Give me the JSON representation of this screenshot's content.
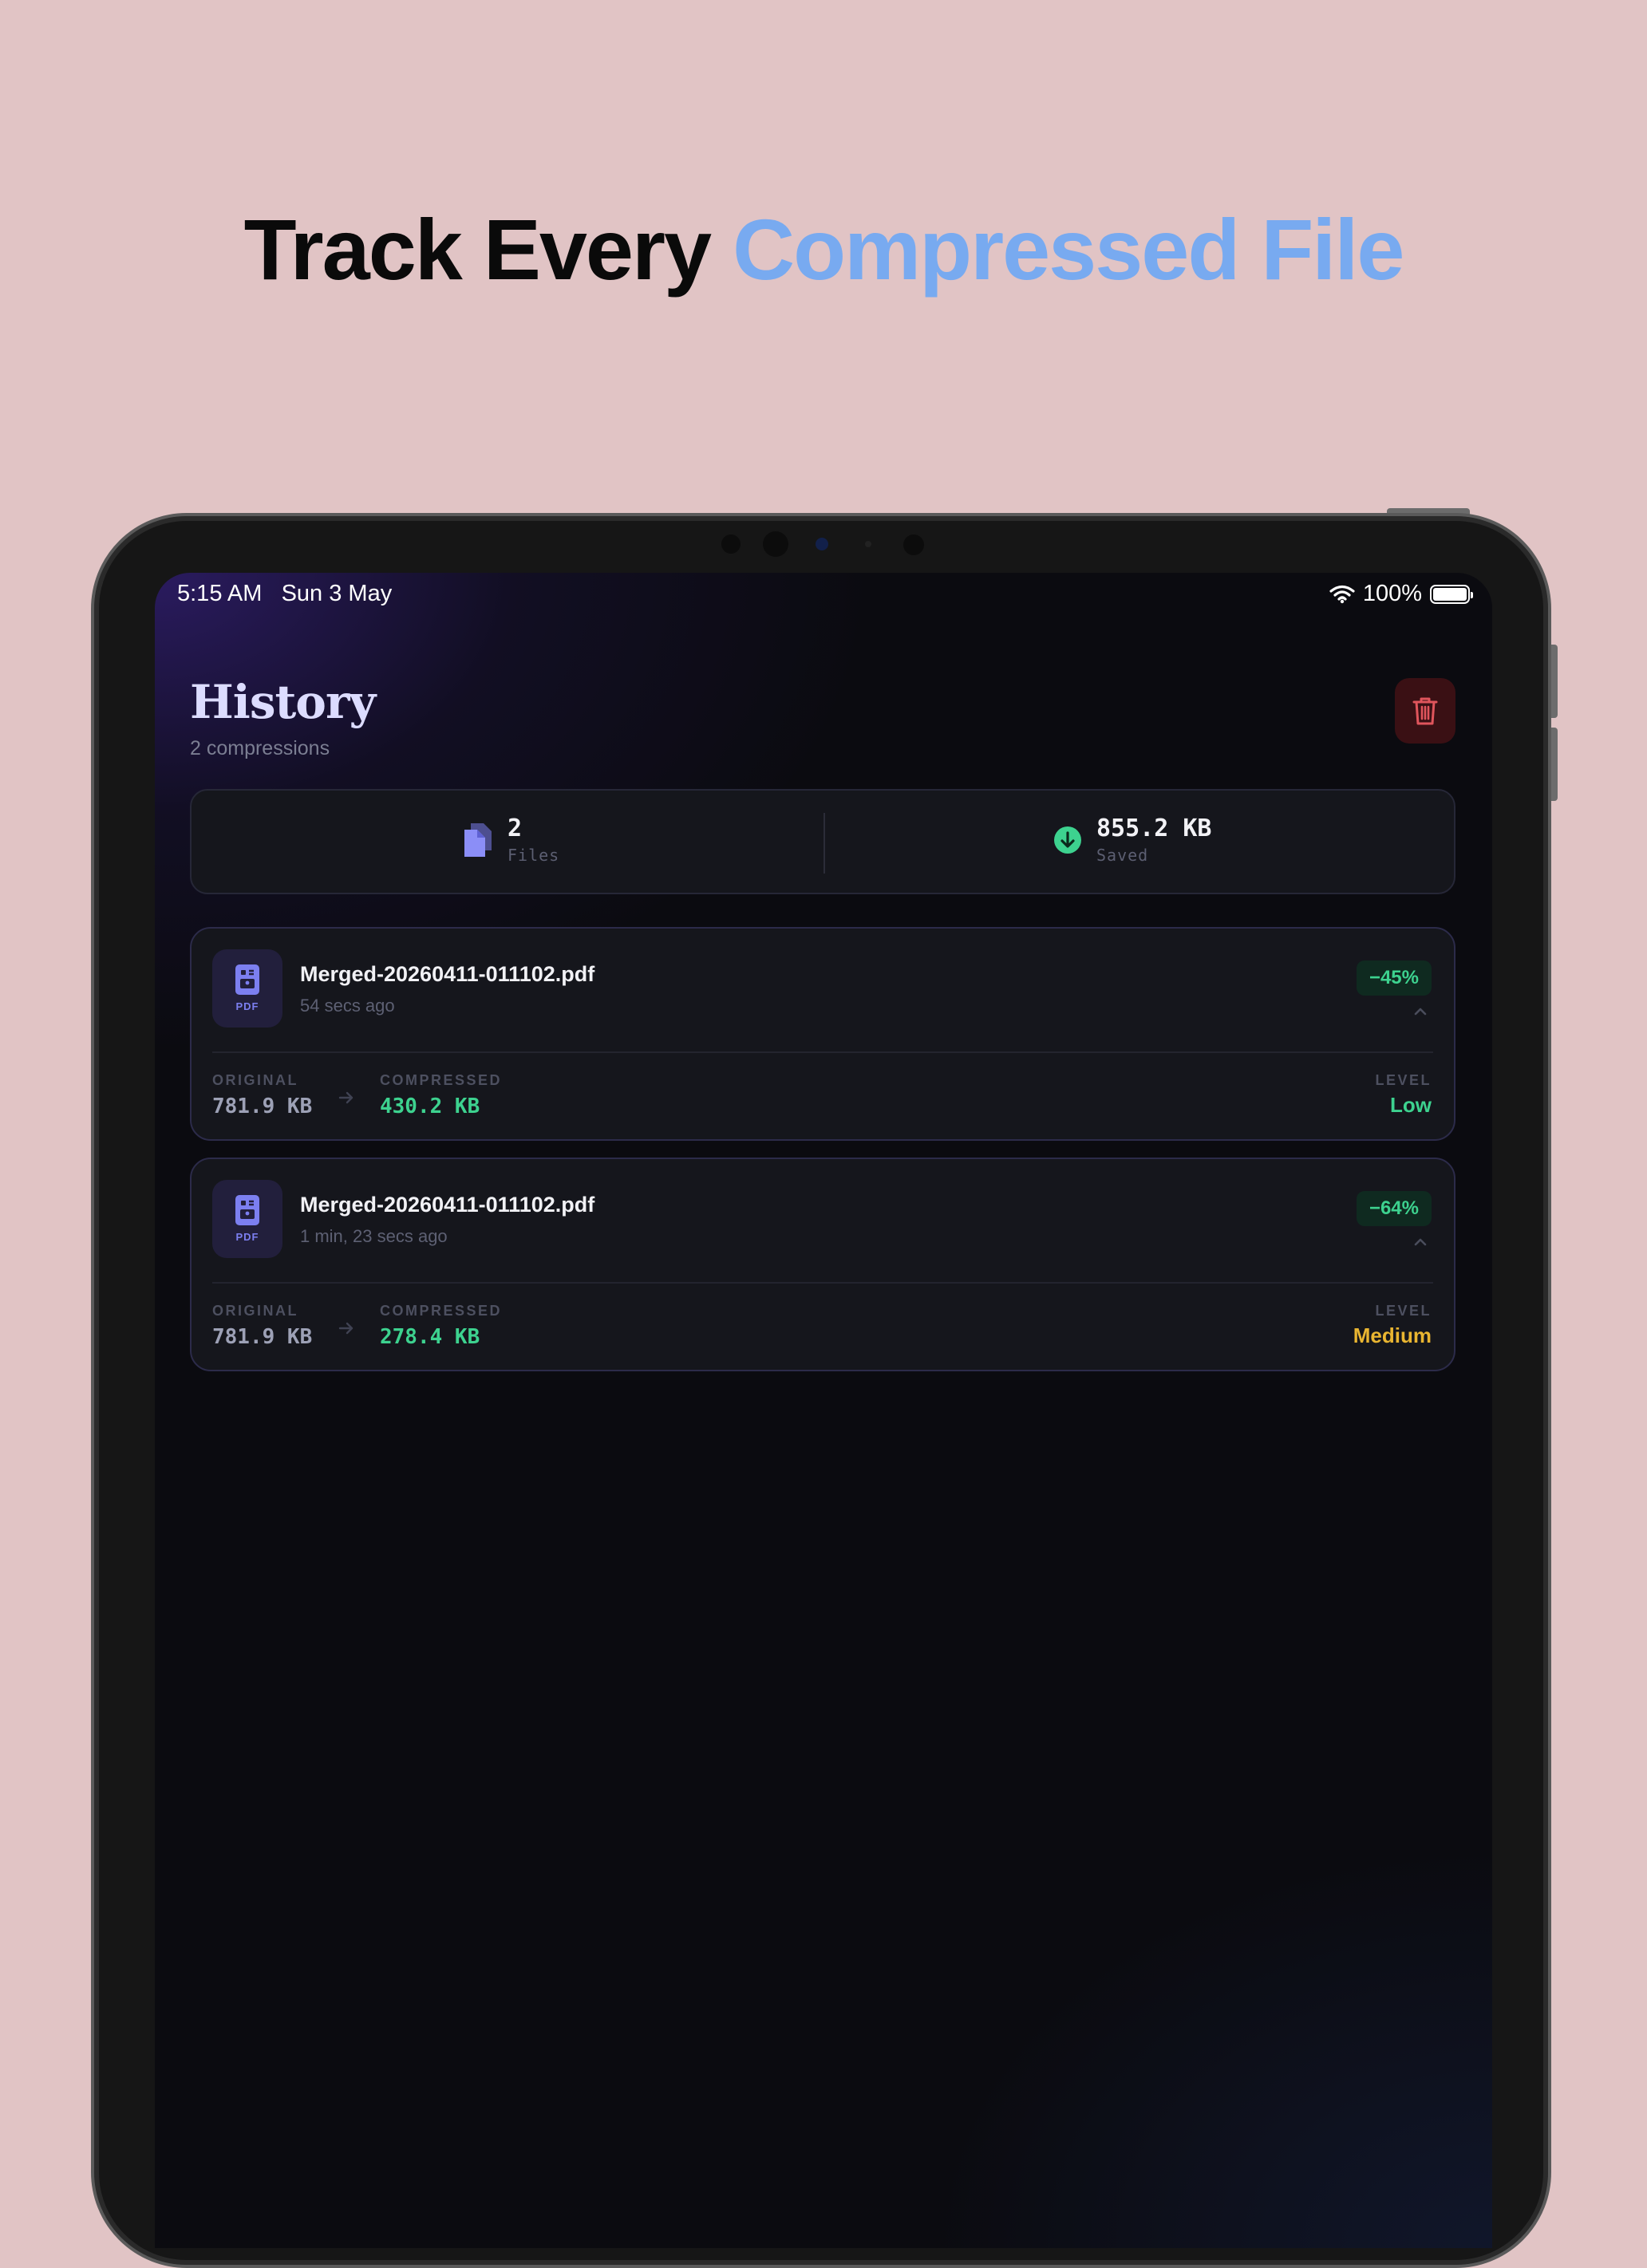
{
  "headline": {
    "part1": "Track Every ",
    "part2": "Compressed File",
    "accent_color": "#78aaf0"
  },
  "statusbar": {
    "time": "5:15 AM",
    "date": "Sun 3 May",
    "battery": "100%"
  },
  "header": {
    "title": "History",
    "subtitle": "2 compressions",
    "clear_icon": "trash-icon"
  },
  "stats": {
    "files": {
      "value": "2",
      "label": "Files",
      "icon": "documents-icon"
    },
    "saved": {
      "value": "855.2 KB",
      "label": "Saved",
      "icon": "download-circle-icon"
    }
  },
  "history": [
    {
      "file_type": "PDF",
      "name": "Merged-20260411-011102.pdf",
      "time": "54 secs ago",
      "reduction": "−45%",
      "original_label": "ORIGINAL",
      "original": "781.9 KB",
      "compressed_label": "COMPRESSED",
      "compressed": "430.2 KB",
      "level_label": "LEVEL",
      "level": "Low",
      "level_color": "#3dd28f"
    },
    {
      "file_type": "PDF",
      "name": "Merged-20260411-011102.pdf",
      "time": "1 min, 23 secs ago",
      "reduction": "−64%",
      "original_label": "ORIGINAL",
      "original": "781.9 KB",
      "compressed_label": "COMPRESSED",
      "compressed": "278.4 KB",
      "level_label": "LEVEL",
      "level": "Medium",
      "level_color": "#e9b531"
    }
  ],
  "colors": {
    "positive": "#3dd28f",
    "accent_icon": "#7c7ff0",
    "danger": "#e0555c",
    "original_value": "#9da1b6"
  }
}
